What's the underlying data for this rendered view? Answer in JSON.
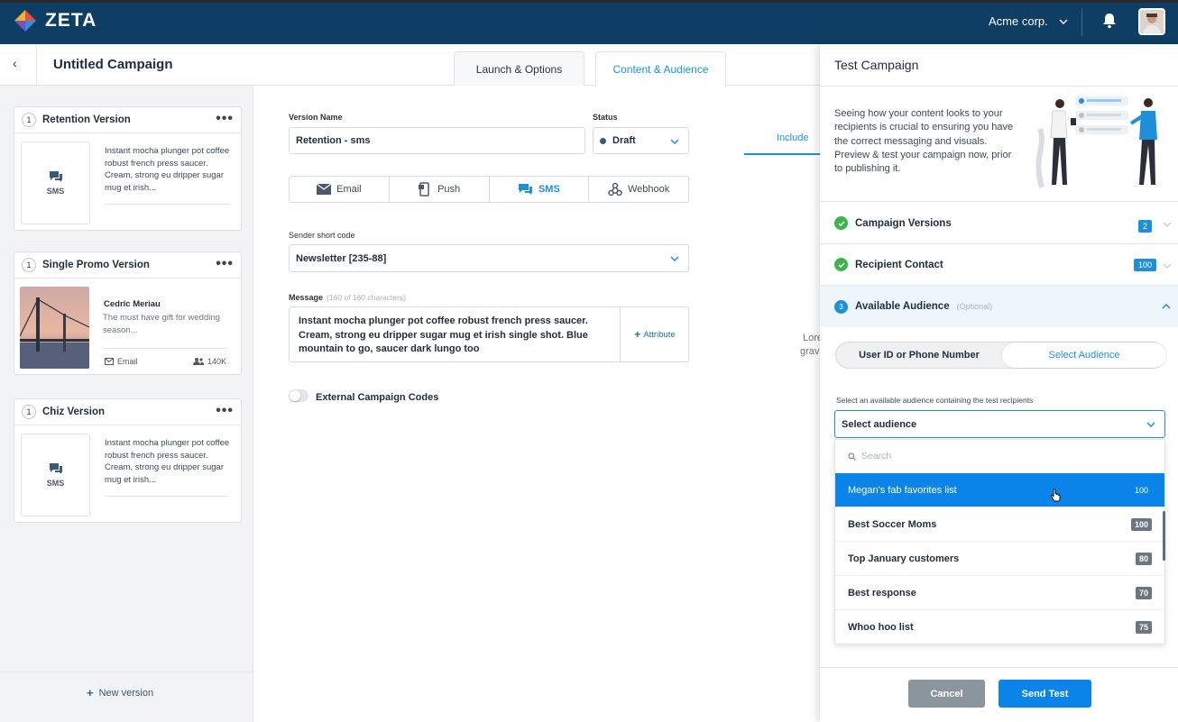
{
  "app": {
    "brand": "ZETA",
    "account": "Acme corp."
  },
  "header": {
    "title": "Untitled Campaign",
    "back_glyph": "‹",
    "tabs": [
      {
        "label": "Launch & Options"
      },
      {
        "label": "Content & Audience"
      }
    ]
  },
  "versions": [
    {
      "num": "1",
      "title": "Retention Version",
      "channel": "SMS",
      "text": "Instant mocha plunger pot coffee robust french press saucer. Cream, strong eu dripper sugar mug et irish..."
    },
    {
      "num": "1",
      "title": "Single Promo Version",
      "author": "Cedric Meriau",
      "text": "The must have gift for wedding season...",
      "channel_label": "Email",
      "count": "140K"
    },
    {
      "num": "1",
      "title": "Chiz Version",
      "channel": "SMS",
      "text": "Instant mocha plunger pot coffee robust french press saucer. Cream, strong eu dripper sugar mug et irish..."
    }
  ],
  "new_version": "New version",
  "form": {
    "version_name_label": "Version Name",
    "version_name": "Retention - sms",
    "status_label": "Status",
    "status": "Draft",
    "channels": [
      "Email",
      "Push",
      "SMS",
      "Webhook"
    ],
    "sender_label": "Sender short code",
    "sender": "Newsletter [235-88]",
    "message_label": "Message",
    "message_hint": "(160 of 160 characters)",
    "message": "Instant mocha plunger pot coffee robust french press saucer. Cream, strong eu dripper sugar mug et irish single shot. Blue mountain to go, saucer dark lungo too",
    "attribute": "Attribute",
    "external_codes": "External Campaign Codes"
  },
  "behind": {
    "include": "Include",
    "lore": "Lore",
    "grav": "grav"
  },
  "drawer": {
    "title": "Test Campaign",
    "intro": "Seeing how your content looks to your recipients is crucial to ensuring you have the correct messaging and visuals. Preview & test your campaign now, prior to publishing it.",
    "steps": [
      {
        "label": "Campaign Versions",
        "badge": "2"
      },
      {
        "label": "Recipient Contact",
        "badge": "100"
      },
      {
        "num": "3",
        "label": "Available Audience",
        "optional": "(Optional)"
      }
    ],
    "toggle": {
      "a": "User ID or Phone Number",
      "b": "Select Audience"
    },
    "select_hint": "Select an available audience containing the test recipients",
    "select_value": "Select audience",
    "search_placeholder": "Search",
    "audiences": [
      {
        "name": "Megan's fab favorites list",
        "count": "100"
      },
      {
        "name": "Best Soccer Moms",
        "count": "100"
      },
      {
        "name": "Top January customers",
        "count": "80"
      },
      {
        "name": "Best response",
        "count": "70"
      },
      {
        "name": "Whoo hoo list",
        "count": "75"
      }
    ],
    "cancel": "Cancel",
    "send": "Send Test"
  },
  "colors": {
    "topbar": "#0e3e63",
    "accent": "#1e90d9",
    "selected": "#0a84e8",
    "success": "#3cb44b"
  }
}
